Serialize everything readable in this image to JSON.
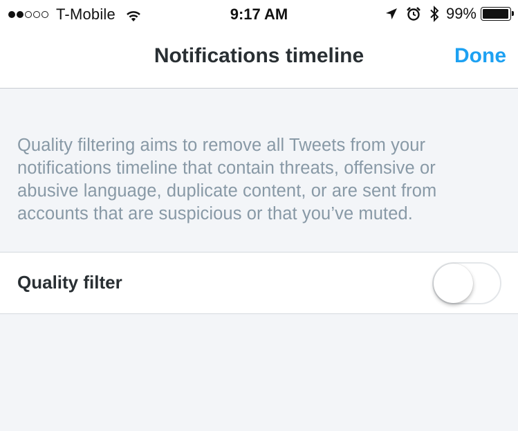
{
  "status_bar": {
    "carrier": "T-Mobile",
    "signal_bars_filled": 2,
    "signal_bars_total": 5,
    "time": "9:17 AM",
    "battery_percent": "99%",
    "icons": [
      "wifi-icon",
      "location-arrow-icon",
      "alarm-icon",
      "bluetooth-icon",
      "battery-icon"
    ]
  },
  "nav": {
    "title": "Notifications timeline",
    "done_label": "Done"
  },
  "description": "Quality filtering aims to remove all Tweets from your notifications timeline that contain threats, offensive or abusive language, duplicate content, or are sent from accounts that are suspicious or that you’ve muted.",
  "settings": {
    "quality_filter_label": "Quality filter",
    "quality_filter_on": false
  },
  "colors": {
    "accent": "#1da1f2",
    "background": "#f3f5f8",
    "description_text": "#8899a6",
    "primary_text": "#292f33"
  }
}
